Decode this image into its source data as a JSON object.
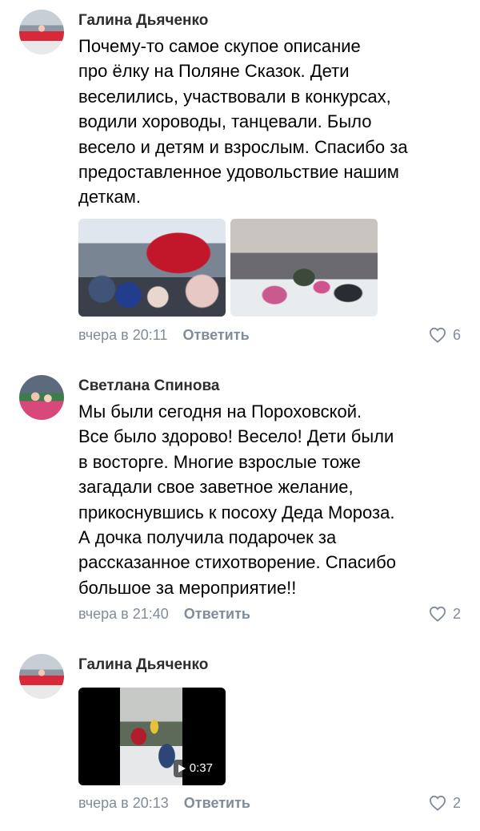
{
  "comments": [
    {
      "author": "Галина Дьяченко",
      "lines": [
        "Почему-то самое скупое описание",
        "про ёлку на Поляне Сказок. Дети",
        "веселились, участвовали в конкурсах,",
        "водили хороводы, танцевали. Было",
        "весело и детям и взрослым. Спасибо за",
        "предоставленное удовольствие нашим",
        "деткам."
      ],
      "time": "вчера в 20:11",
      "reply": "Ответить",
      "likes": "6"
    },
    {
      "author": "Светлана Спинова",
      "lines": [
        "Мы были сегодня на Пороховской.",
        "Все было здорово! Весело! Дети были",
        "в восторге. Многие взрослые тоже",
        "загадали свое заветное желание,",
        "прикоснувшись к посоху Деда Мороза.",
        "А дочка получила подарочек за",
        "рассказанное стихотворение. Спасибо",
        "большое за мероприятие!!"
      ],
      "time": "вчера в 21:40",
      "reply": "Ответить",
      "likes": "2"
    },
    {
      "author": "Галина Дьяченко",
      "video_duration": "0:37",
      "time": "вчера в 20:13",
      "reply": "Ответить",
      "likes": "2"
    }
  ],
  "colors": {
    "meta": "#818c99",
    "author": "#2c2d2e",
    "text": "#000000",
    "background": "#ffffff"
  },
  "icons": {
    "like": "heart-outline-icon",
    "play": "play-icon"
  }
}
